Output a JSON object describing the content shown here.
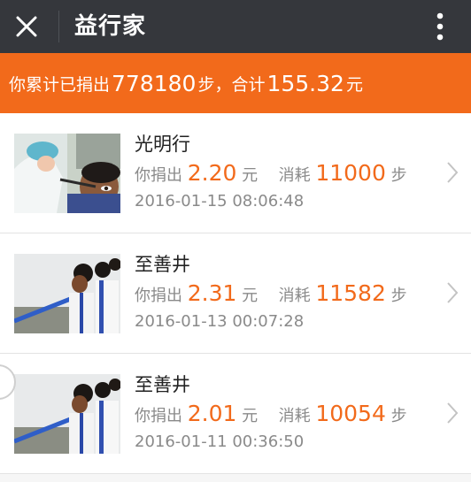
{
  "header": {
    "title": "益行家",
    "close_icon": "close-icon",
    "more_icon": "more-vertical-icon",
    "bg_color": "#35373c"
  },
  "summary": {
    "prefix": "你累计已捐出",
    "total_steps": "778180",
    "steps_unit": "步，合计",
    "total_amount": "155.32",
    "amount_unit": "元",
    "bg_color": "#f26a1b"
  },
  "donations": [
    {
      "project": "光明行",
      "donate_label": "你捐出",
      "amount": "2.20",
      "amount_unit": "元",
      "consume_label": "消耗",
      "steps": "11000",
      "steps_unit": "步",
      "date": "2016-01-15 08:06:48",
      "thumb_icon": "eye-exam-photo"
    },
    {
      "project": "至善井",
      "donate_label": "你捐出",
      "amount": "2.31",
      "amount_unit": "元",
      "consume_label": "消耗",
      "steps": "11582",
      "steps_unit": "步",
      "date": "2016-01-13 00:07:28",
      "thumb_icon": "children-drinking-water-photo"
    },
    {
      "project": "至善井",
      "donate_label": "你捐出",
      "amount": "2.01",
      "amount_unit": "元",
      "consume_label": "消耗",
      "steps": "10054",
      "steps_unit": "步",
      "date": "2016-01-11 00:36:50",
      "thumb_icon": "children-drinking-water-photo"
    }
  ],
  "accent_color": "#f26a1b"
}
